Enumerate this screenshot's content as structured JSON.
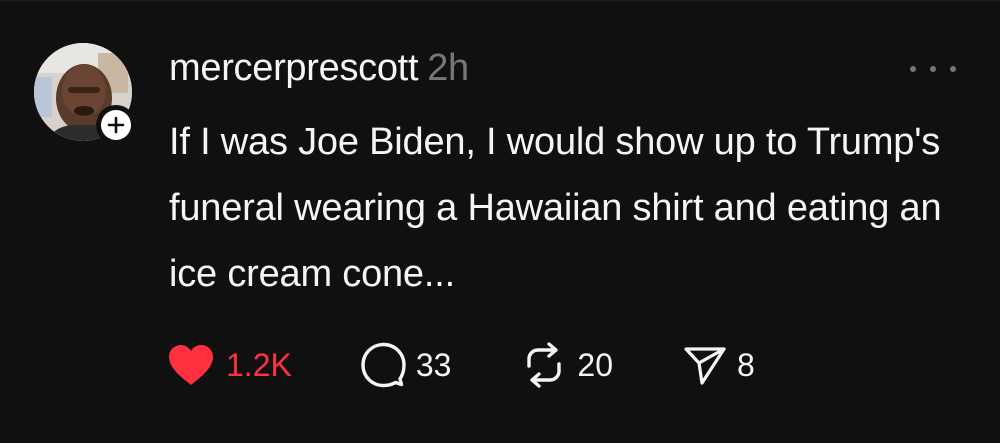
{
  "post": {
    "username": "mercerprescott",
    "timestamp": "2h",
    "text": "If I was Joe Biden, I would show up to Trump's funeral wearing a Hawaiian shirt and eating an ice cream cone...",
    "actions": {
      "likes": "1.2K",
      "replies": "33",
      "reposts": "20",
      "shares": "8"
    },
    "icons": {
      "like": "heart-icon",
      "reply": "comment-icon",
      "repost": "repost-icon",
      "share": "send-icon",
      "more": "more-options-icon",
      "follow": "plus-icon"
    },
    "colors": {
      "background": "#101010",
      "text": "#f3f5f7",
      "muted": "#777777",
      "like": "#ff3040"
    }
  }
}
